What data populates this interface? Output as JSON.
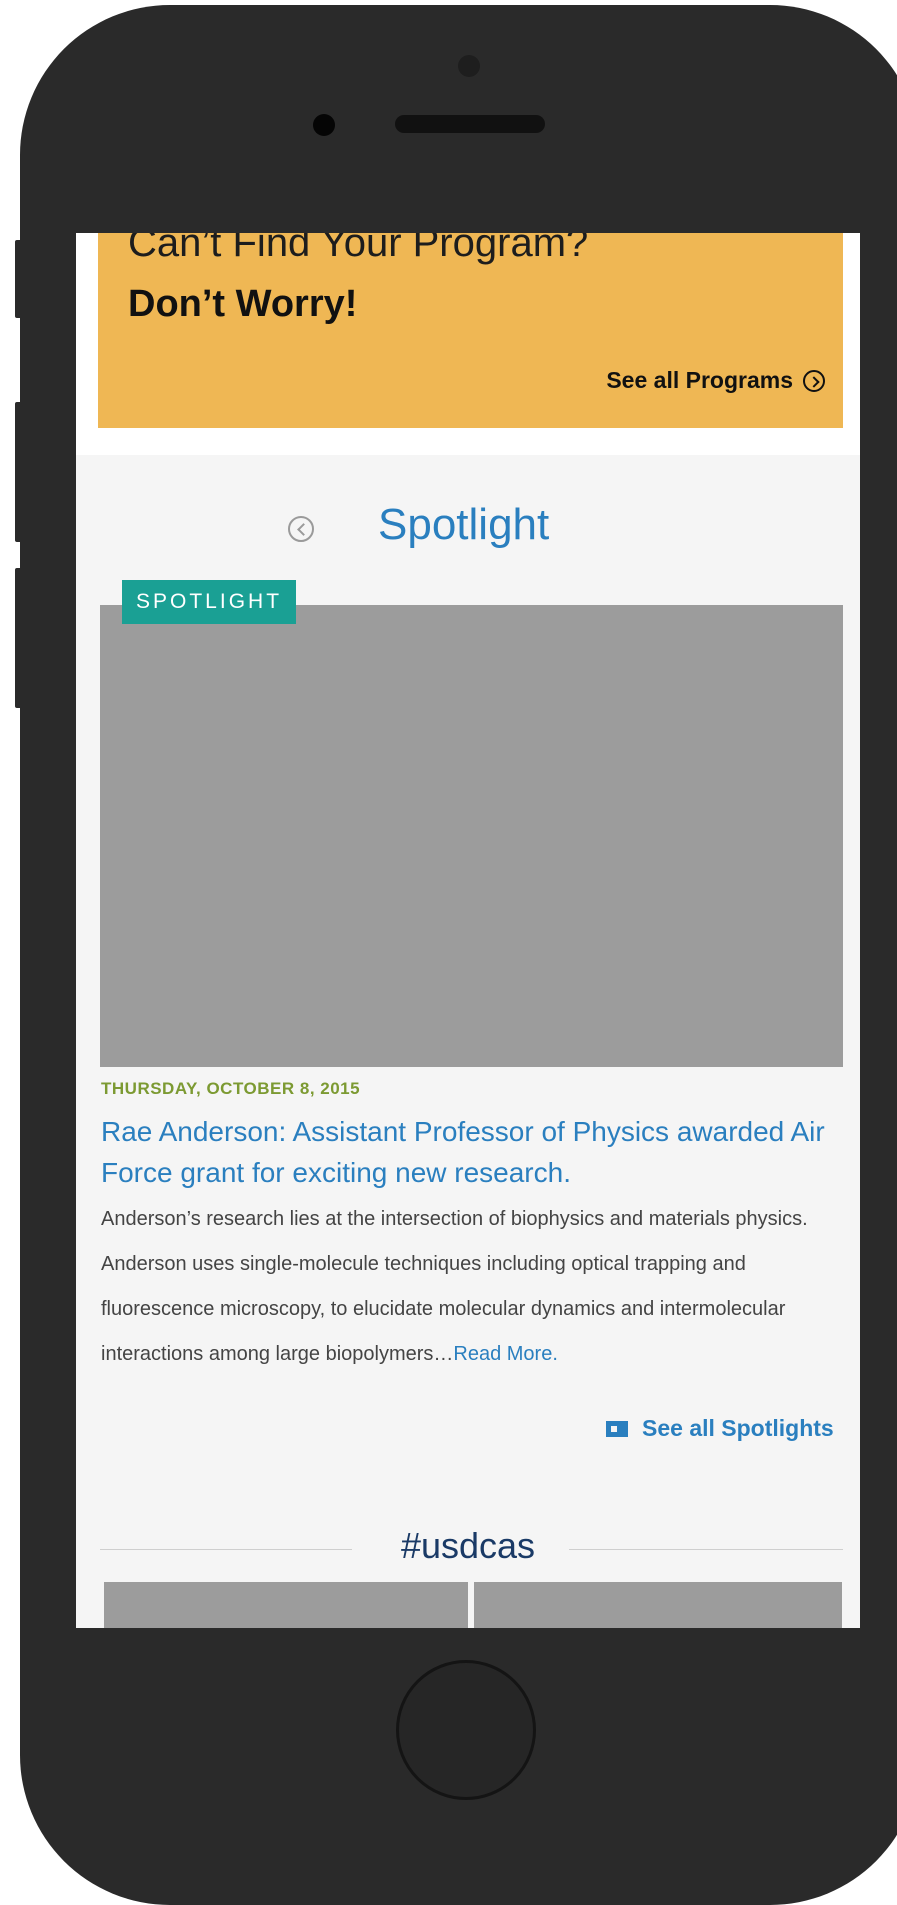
{
  "cta": {
    "title": "Can’t Find Your Program?",
    "subtitle": "Don’t Worry!",
    "link": "See all Programs",
    "link_icon": "chevron-right-circle-icon",
    "background": "#efb754"
  },
  "spotlight": {
    "heading": "Spotlight",
    "prev_icon": "chevron-left-circle-icon",
    "badge": "SPOTLIGHT",
    "date": "THURSDAY, OCTOBER 8, 2015",
    "headline": "Rae Anderson: Assistant Professor of Physics awarded Air Force grant for exciting new research.",
    "body": "Anderson’s research lies at the intersection of biophysics and materials physics. Anderson uses single-molecule techniques including optical trapping and fluorescence microscopy, to elucidate molecular dynamics and intermolecular interactions among large biopolymers…",
    "read_more": "Read More.",
    "see_all": "See all Spotlights",
    "see_all_icon": "newspaper-icon",
    "accent_color": "#2a7fbf",
    "badge_color": "#1aa094",
    "date_color": "#7c9a32"
  },
  "social": {
    "hashtag": "#usdcas"
  }
}
